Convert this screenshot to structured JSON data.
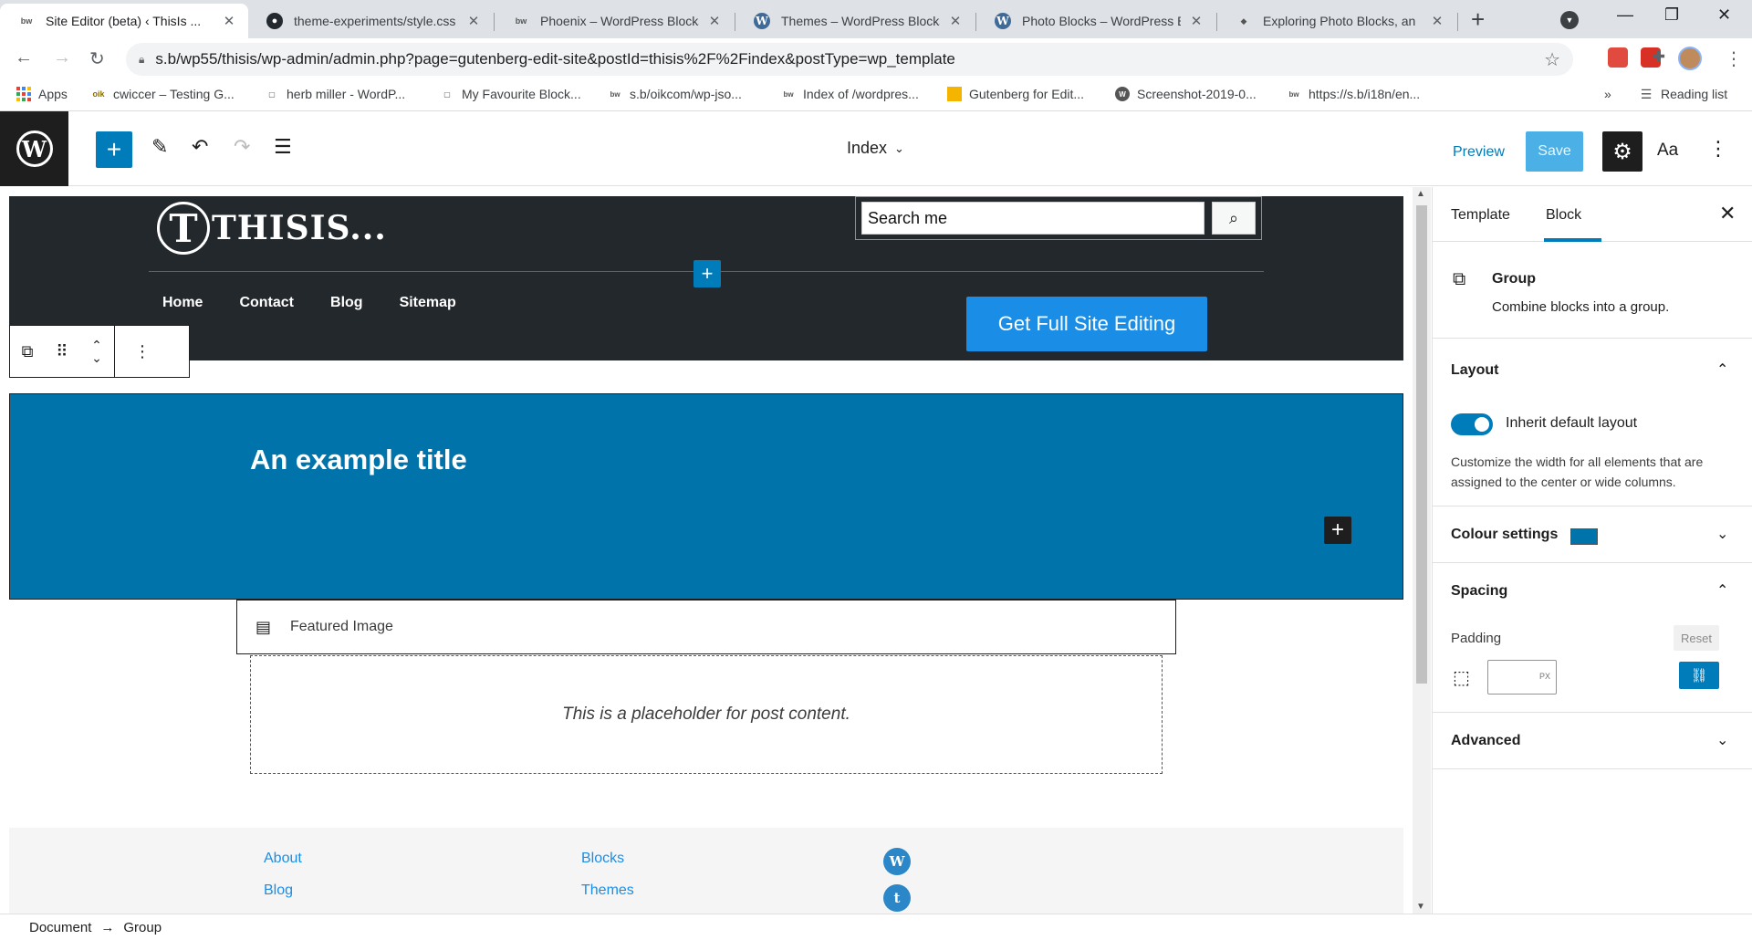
{
  "browser": {
    "tabs": [
      {
        "title": "Site Editor (beta) ‹ ThisIs ...",
        "favicon": "bw-favicon",
        "active": true
      },
      {
        "title": "theme-experiments/style.css",
        "favicon": "github-icon"
      },
      {
        "title": "Phoenix – WordPress Blocks",
        "favicon": "bw-favicon"
      },
      {
        "title": "Themes – WordPress Blocks",
        "favicon": "wordpress-icon"
      },
      {
        "title": "Photo Blocks – WordPress B",
        "favicon": "wordpress-icon"
      },
      {
        "title": "Exploring Photo Blocks, an",
        "favicon": "tag-icon"
      }
    ],
    "url": "s.b/wp55/thisis/wp-admin/admin.php?page=gutenberg-edit-site&postId=thisis%2F%2Findex&postType=wp_template",
    "bookmarks": [
      {
        "label": "Apps"
      },
      {
        "label": "cwiccer – Testing G..."
      },
      {
        "label": "herb miller - WordP..."
      },
      {
        "label": "My Favourite Block..."
      },
      {
        "label": "s.b/oikcom/wp-jso..."
      },
      {
        "label": "Index of /wordpres..."
      },
      {
        "label": "Gutenberg for Edit..."
      },
      {
        "label": "Screenshot-2019-0..."
      },
      {
        "label": "https://s.b/i18n/en..."
      }
    ],
    "bookmarks_overflow": "»",
    "reading_list": "Reading list"
  },
  "editor": {
    "template_selector": "Index",
    "preview_label": "Preview",
    "save_label": "Save",
    "styles_label": "Aa"
  },
  "site_header": {
    "logo_letter": "T",
    "site_name": "THISIS...",
    "search_placeholder": "Search me",
    "nav": [
      "Home",
      "Contact",
      "Blog",
      "Sitemap"
    ],
    "cta_label": "Get Full Site Editing"
  },
  "cover": {
    "title": "An example title"
  },
  "featured_image_label": "Featured Image",
  "post_content_placeholder": "This is a placeholder for post content.",
  "footer": {
    "col1": [
      "About",
      "Blog"
    ],
    "col2": [
      "Blocks",
      "Themes"
    ],
    "social": [
      "wordpress-icon",
      "twitter-icon"
    ]
  },
  "sidebar": {
    "tabs": [
      "Template",
      "Block"
    ],
    "active_tab": "Block",
    "block_name": "Group",
    "block_description": "Combine blocks into a group.",
    "layout": {
      "title": "Layout",
      "toggle_label": "Inherit default layout",
      "toggle_on": true,
      "help": "Customize the width for all elements that are assigned to the center or wide columns."
    },
    "colour": {
      "title": "Colour settings",
      "swatch": "#0073aa"
    },
    "spacing": {
      "title": "Spacing",
      "padding_label": "Padding",
      "reset_label": "Reset",
      "unit": "PX",
      "value": ""
    },
    "advanced": {
      "title": "Advanced"
    }
  },
  "breadcrumb": {
    "root": "Document",
    "separator": "→",
    "current": "Group"
  },
  "colors": {
    "wp_blue": "#007cba",
    "header_dark": "#23282d",
    "cover_blue": "#0073aa",
    "cta_blue": "#1a8ee6"
  }
}
